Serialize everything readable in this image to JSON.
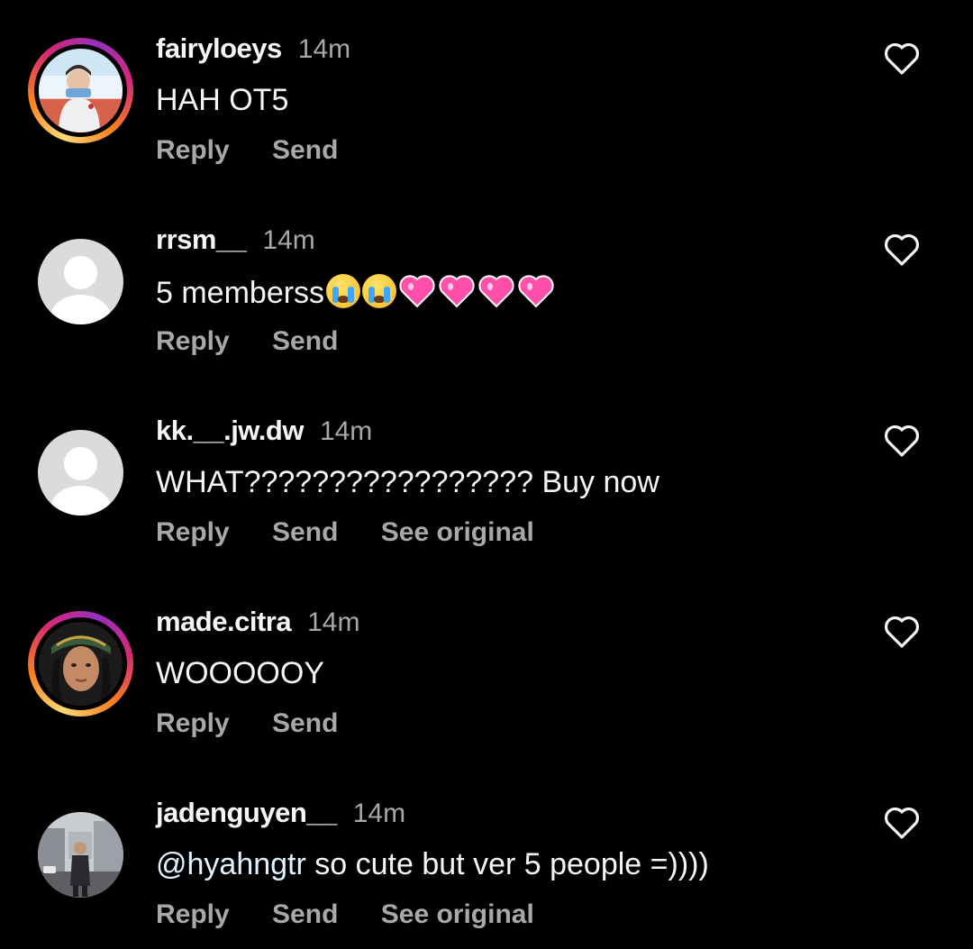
{
  "comments": [
    {
      "username": "fairyloeys",
      "time": "14m",
      "text": "HAH OT5",
      "actions": {
        "reply": "Reply",
        "send": "Send"
      },
      "avatar": "photo-with-story-ring"
    },
    {
      "username": "rrsm__",
      "time": "14m",
      "text": "5 memberss",
      "emojis": [
        "loudly-crying-face",
        "loudly-crying-face",
        "sparkling-heart",
        "sparkling-heart",
        "sparkling-heart",
        "sparkling-heart"
      ],
      "actions": {
        "reply": "Reply",
        "send": "Send"
      },
      "avatar": "default-avatar"
    },
    {
      "username": "kk.__.jw.dw",
      "time": "14m",
      "text": "WHAT????????????????? Buy now",
      "actions": {
        "reply": "Reply",
        "send": "Send",
        "see_original": "See original"
      },
      "avatar": "default-avatar"
    },
    {
      "username": "made.citra",
      "time": "14m",
      "text": "WOOOOOY",
      "actions": {
        "reply": "Reply",
        "send": "Send"
      },
      "avatar": "photo-with-story-ring"
    },
    {
      "username": "jadenguyen__",
      "time": "14m",
      "mention": "@hyahngtr",
      "text": " so cute but ver 5 people =))))",
      "actions": {
        "reply": "Reply",
        "send": "Send",
        "see_original": "See original"
      },
      "avatar": "photo"
    }
  ],
  "colors": {
    "background": "#000000",
    "primary_text": "#f5f5f5",
    "secondary_text": "#a8a8a8",
    "mention": "#e0f1ff"
  },
  "icons": {
    "like": "heart-outline-icon"
  }
}
